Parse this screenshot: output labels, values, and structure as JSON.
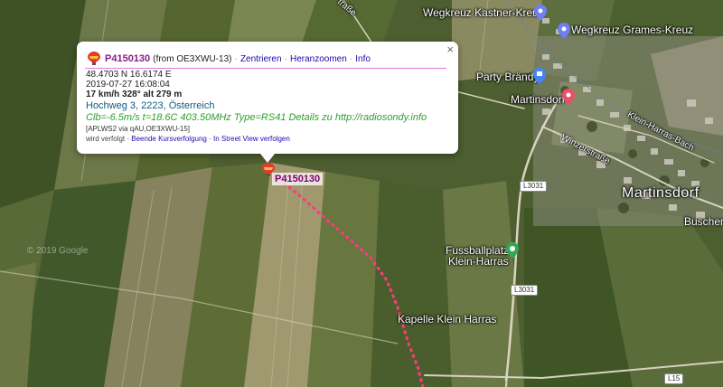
{
  "map": {
    "places": {
      "martinsdorf_large": "Martinsdorf",
      "martinsdorf_poi": "Martinsdorf",
      "party_brandy": "Party Brändy",
      "wegkreuz_kastner": "Wegkreuz Kastner-Kreuz",
      "wegkreuz_grames": "Wegkreuz Grames-Kreuz",
      "fussballplatz_line1": "Fussballplatz",
      "fussballplatz_line2": "Klein-Harras",
      "kapelle": "Kapelle Klein Harras",
      "buschens": "Buschens",
      "winzerstrasse": "Winzerstraße",
      "klein_harras_bach": "Klein-Harras-Bach",
      "strasse_top": "traße"
    },
    "road_shields": {
      "l3031_a": "L3031",
      "l3031_b": "L3031",
      "l15": "L15"
    },
    "copyright": "© 2019 Google",
    "track_color": "#ff3a7a"
  },
  "marker": {
    "callsign_label": "P4150130"
  },
  "infowindow": {
    "close_symbol": "×",
    "callsign": "P4150130",
    "from": "(from OE3XWU-13)",
    "links": {
      "center": "Zentrieren",
      "zoom": "Heranzoomen",
      "info": "Info"
    },
    "separator": "·",
    "coords": "48.4703 N 16.6174 E",
    "timestamp": "2019-07-27 16:08:04",
    "speed_line": "17 km/h 328° alt 279 m",
    "address": "Hochweg 3, 2223, Österreich",
    "comment": "Clb=-6.5m/s t=18.6C 403.50MHz Type=RS41 Details zu http://radiosondy.info",
    "path": "[APLWS2 via qAU,OE3XWU-15]",
    "footer": {
      "tracked": "wird verfolgt",
      "stop_tracking": "Beende Kursverfolgung",
      "street_view": "In Street View verfolgen"
    }
  }
}
